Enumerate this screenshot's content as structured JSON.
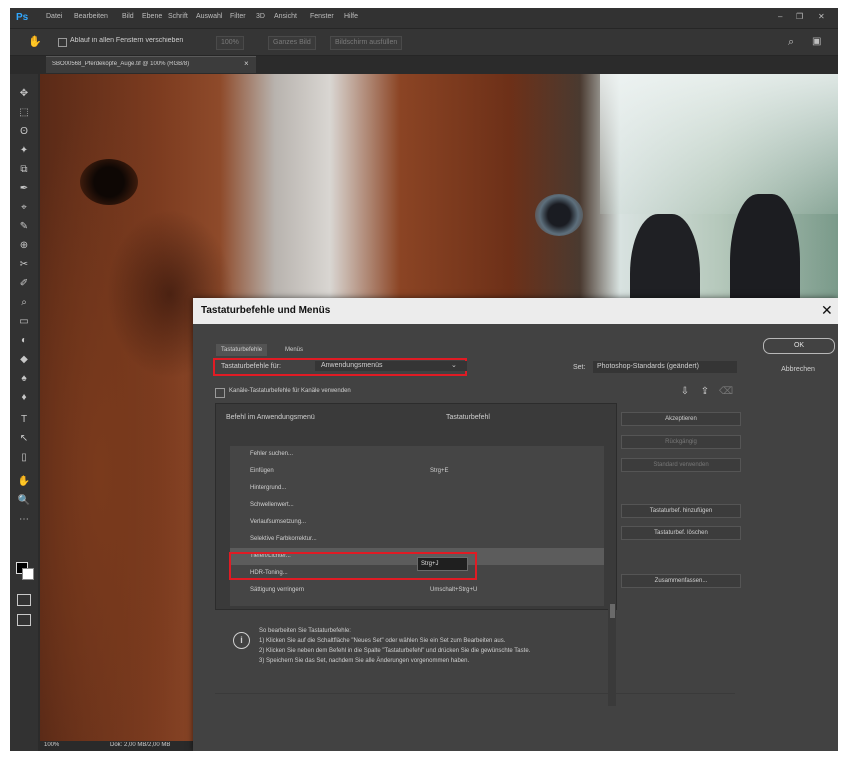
{
  "app": {
    "logo": "Ps",
    "menu": [
      "Datei",
      "Bearbeiten",
      "Bild",
      "Ebene",
      "Schrift",
      "Auswahl",
      "Filter",
      "3D",
      "Ansicht",
      "Fenster",
      "Hilfe"
    ],
    "window_controls": [
      "–",
      "❐",
      "✕"
    ]
  },
  "options_bar": {
    "tool_icon": "move-icon",
    "checkbox_label": "Ablauf in allen Fenstern verschieben",
    "btn_1": "100%",
    "btn_2": "Ganzes Bild",
    "btn_3": "Bildschirm ausfüllen"
  },
  "document": {
    "tab_title": "SBO00568_Pferdeköpfe_Auge.tif @ 100% (RGB/8)",
    "tab_close": "×",
    "zoom": "100%",
    "doc_info": "Dok: 2,00 MB/2,00 MB"
  },
  "toolbar": {
    "tools": [
      "✥",
      "⬚",
      "ʘ",
      "✦",
      "⧉",
      "✒",
      "⌖",
      "✎",
      "⊕",
      "✂",
      "✐",
      "⌕",
      "▭",
      "◐",
      "◆",
      "♠",
      "♦",
      "T",
      "↖",
      "▯",
      "✋",
      "🔍",
      "⋯"
    ]
  },
  "dialog": {
    "title": "Tastaturbefehle und Menüs",
    "close": "✕",
    "tabs": {
      "shortcuts": "Tastaturbefehle",
      "menus": "Menüs"
    },
    "ok": "OK",
    "cancel": "Abbrechen",
    "shortcuts_for_label": "Tastaturbefehle für:",
    "shortcuts_for_value": "Anwendungsmenüs",
    "caret": "⌄",
    "set_label": "Set:",
    "set_value": "Photoshop-Standards (geändert)",
    "legacy_label": "Kanäle-Tastaturbefehle für Kanäle verwenden",
    "col_command": "Befehl im Anwendungsmenü",
    "col_shortcut": "Tastaturbefehl",
    "rows": [
      {
        "label": "Fehler suchen...",
        "shortcut": ""
      },
      {
        "label": "Einfügen",
        "shortcut": "Strg+E"
      },
      {
        "label": "Hintergrund...",
        "shortcut": ""
      },
      {
        "label": "Schwellenwert...",
        "shortcut": ""
      },
      {
        "label": "Verlaufsumsetzung...",
        "shortcut": ""
      },
      {
        "label": "Selektive Farbkorrektur...",
        "shortcut": ""
      },
      {
        "label": "Tiefen/Lichter...",
        "shortcut": "Strg+J"
      },
      {
        "label": "HDR-Toning...",
        "shortcut": ""
      },
      {
        "label": "Sättigung verringern",
        "shortcut": "Umschalt+Strg+U"
      }
    ],
    "shortcut_input": "Strg+J",
    "side_buttons": [
      "Akzeptieren",
      "Rückgängig",
      "Standard verwenden",
      "Tastaturbef. hinzufügen",
      "Tastaturbef. löschen",
      "Zusammenfassen..."
    ],
    "info": [
      "So bearbeiten Sie Tastaturbefehle:",
      "1) Klicken Sie auf die Schaltfläche \"Neues Set\" oder wählen Sie ein Set zum Bearbeiten aus.",
      "2) Klicken Sie neben dem Befehl in die Spalte \"Tastaturbefehl\" und drücken Sie die gewünschte Taste.",
      "3) Speichern Sie das Set, nachdem Sie alle Änderungen vorgenommen haben."
    ],
    "info_icon": "i"
  }
}
